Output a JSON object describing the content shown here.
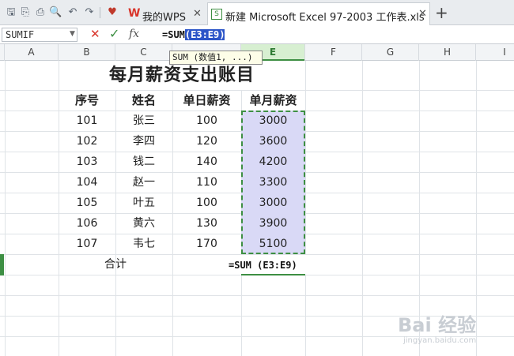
{
  "tabs": [
    {
      "label": "我的WPS"
    },
    {
      "label": "新建 Microsoft Excel 97-2003 工作表.xls"
    }
  ],
  "formula_bar": {
    "name_box": "SUMIF",
    "cancel": "✕",
    "confirm": "✓",
    "fx": "fx",
    "formula_prefix": "=SUM",
    "formula_range": "(E3:E9)"
  },
  "tooltip": "SUM (数值1, ...)",
  "columns": [
    "A",
    "B",
    "C",
    "D",
    "E",
    "F",
    "G",
    "H",
    "I"
  ],
  "sheet": {
    "title": "每月薪资支出账目",
    "headers": [
      "序号",
      "姓名",
      "单日薪资",
      "单月薪资"
    ],
    "rows": [
      [
        "101",
        "张三",
        "100",
        "3000"
      ],
      [
        "102",
        "李四",
        "120",
        "3600"
      ],
      [
        "103",
        "钱二",
        "140",
        "4200"
      ],
      [
        "104",
        "赵一",
        "110",
        "3300"
      ],
      [
        "105",
        "叶五",
        "100",
        "3000"
      ],
      [
        "106",
        "黄六",
        "130",
        "3900"
      ],
      [
        "107",
        "韦七",
        "170",
        "5100"
      ]
    ],
    "total_label": "合计",
    "total_formula": "=SUM (E3:E9)"
  },
  "watermark": {
    "text": "Bai 经验",
    "sub": "jingyan.baidu.com"
  },
  "colors": {
    "accent": "#3d8f43",
    "selection": "#d9d9f6",
    "highlight": "#2c55c8"
  }
}
